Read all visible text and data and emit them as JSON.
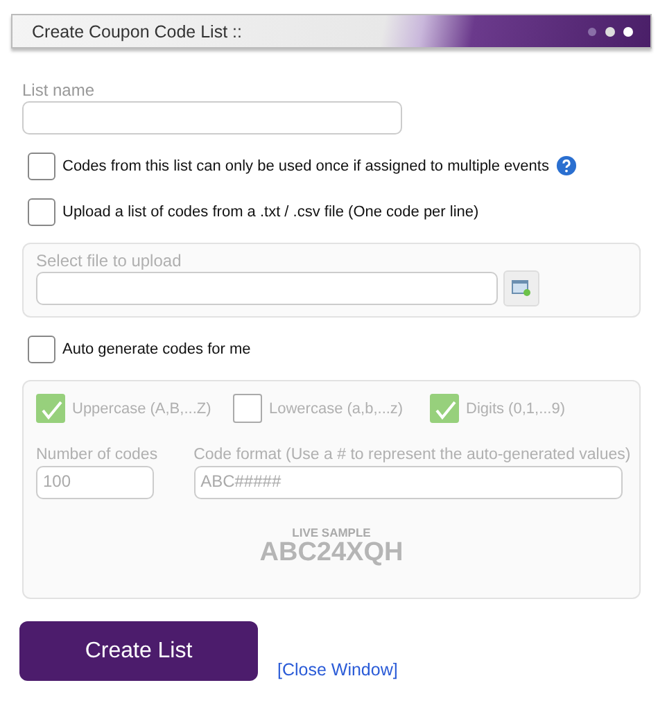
{
  "window": {
    "title": "Create Coupon Code List ::"
  },
  "list_name": {
    "label": "List name"
  },
  "options": [
    {
      "label": "Codes from this list can only be used once if assigned to multiple events",
      "checked": false,
      "help": true
    },
    {
      "label": "Upload a list of codes from a .txt / .csv file (One code per line)",
      "checked": false,
      "help": false
    }
  ],
  "upload": {
    "label": "Select file to upload",
    "disabled": true
  },
  "auto_generate": {
    "label": "Auto generate codes for me",
    "checked": false
  },
  "generator": {
    "disabled": true,
    "charsets": [
      {
        "label": "Uppercase (A,B,...Z)",
        "checked": true
      },
      {
        "label": "Lowercase (a,b,...z)",
        "checked": false
      },
      {
        "label": "Digits (0,1,...9)",
        "checked": true
      }
    ],
    "count": {
      "label": "Number of codes",
      "value": "100"
    },
    "format": {
      "label": "Code format (Use a # to represent the auto-generated values)",
      "value": "ABC#####"
    },
    "sample_label": "LIVE SAMPLE",
    "sample": "ABC24XQH"
  },
  "buttons": {
    "create": "Create List",
    "close": "[Close Window]"
  }
}
